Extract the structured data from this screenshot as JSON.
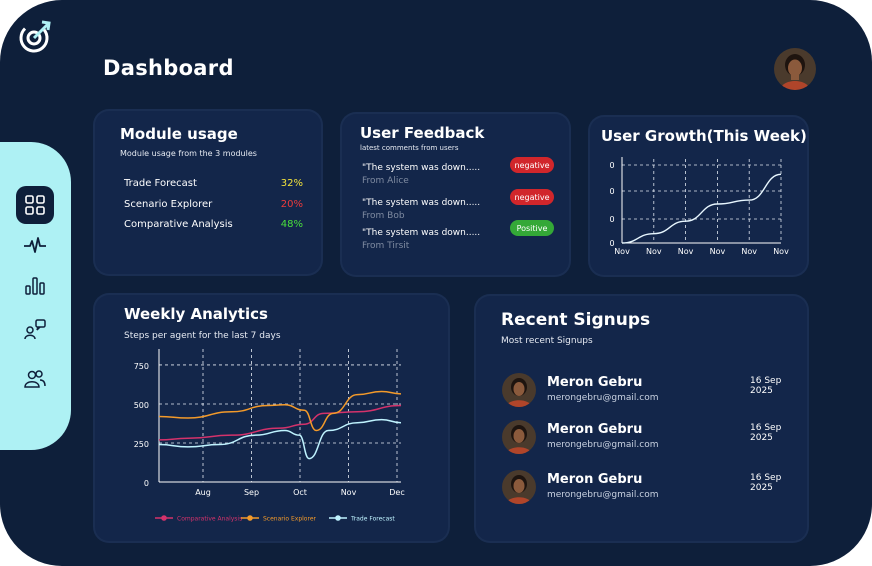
{
  "header": {
    "title": "Dashboard"
  },
  "nav": [
    "dashboard",
    "activity",
    "analytics",
    "feedback",
    "users"
  ],
  "module_usage": {
    "title": "Module usage",
    "subtitle": "Module usage  from the 3 modules",
    "items": [
      {
        "label": "Trade Forecast",
        "value": "32%",
        "color": "#f3e33c"
      },
      {
        "label": "Scenario Explorer",
        "value": "20%",
        "color": "#ee3b3b"
      },
      {
        "label": "Comparative Analysis",
        "value": "48%",
        "color": "#4ae03c"
      }
    ]
  },
  "feedback": {
    "title": "User Feedback",
    "subtitle": "latest comments from users",
    "items": [
      {
        "text": "\"The system was down.....",
        "from": "From Alice",
        "badge": "negative",
        "badge_color": "#d1262b"
      },
      {
        "text": "\"The system was down.....",
        "from": "From Bob",
        "badge": "negative",
        "badge_color": "#d1262b"
      },
      {
        "text": "\"The system was down.....",
        "from": "From Tirsit",
        "badge": "Positive",
        "badge_color": "#34a837"
      }
    ]
  },
  "growth": {
    "title": "User Growth(This Week)",
    "chart_data": {
      "type": "line",
      "x": [
        "Nov",
        "Nov",
        "Nov",
        "Nov",
        "Nov",
        "Nov"
      ],
      "y_ticks": [
        "0",
        "0",
        "0",
        "0"
      ],
      "series": [
        {
          "values": [
            0,
            0.12,
            0.28,
            0.5,
            0.55,
            0.88
          ]
        }
      ],
      "ylim": [
        0,
        1
      ]
    }
  },
  "weekly": {
    "title": "Weekly Analytics",
    "subtitle": "Steps per agent for the last 7 days",
    "chart_data": {
      "type": "line",
      "x": [
        "Aug",
        "Sep",
        "Oct",
        "Nov",
        "Dec"
      ],
      "y_ticks": [
        "0",
        "250",
        "500",
        "750"
      ],
      "ylim": [
        0,
        750
      ],
      "series": [
        {
          "name": "Comparative Analysis",
          "color": "#d4326b",
          "points": [
            [
              0,
              270
            ],
            [
              0.12,
              280
            ],
            [
              0.3,
              300
            ],
            [
              0.5,
              345
            ],
            [
              0.6,
              370
            ],
            [
              0.68,
              440
            ],
            [
              0.82,
              450
            ],
            [
              1,
              490
            ]
          ]
        },
        {
          "name": "Scenario Explorer",
          "color": "#f39a2a",
          "points": [
            [
              0,
              420
            ],
            [
              0.12,
              410
            ],
            [
              0.3,
              450
            ],
            [
              0.45,
              490
            ],
            [
              0.52,
              495
            ],
            [
              0.6,
              460
            ],
            [
              0.65,
              330
            ],
            [
              0.72,
              440
            ],
            [
              0.82,
              560
            ],
            [
              0.92,
              580
            ],
            [
              1,
              565
            ]
          ]
        },
        {
          "name": "Trade Forecast",
          "color": "#bff3ff",
          "points": [
            [
              0,
              240
            ],
            [
              0.12,
              225
            ],
            [
              0.25,
              240
            ],
            [
              0.4,
              300
            ],
            [
              0.52,
              330
            ],
            [
              0.58,
              300
            ],
            [
              0.62,
              150
            ],
            [
              0.7,
              330
            ],
            [
              0.82,
              380
            ],
            [
              0.92,
              400
            ],
            [
              1,
              380
            ]
          ]
        }
      ]
    }
  },
  "signups": {
    "title": "Recent Signups",
    "subtitle": "Most recent Signups",
    "items": [
      {
        "name": "Meron Gebru",
        "email": "merongebru@gmail.com",
        "date": "16 Sep 2025"
      },
      {
        "name": "Meron Gebru",
        "email": "merongebru@gmail.com",
        "date": "16 Sep 2025"
      },
      {
        "name": "Meron Gebru",
        "email": "merongebru@gmail.com",
        "date": "16 Sep 2025"
      }
    ]
  }
}
